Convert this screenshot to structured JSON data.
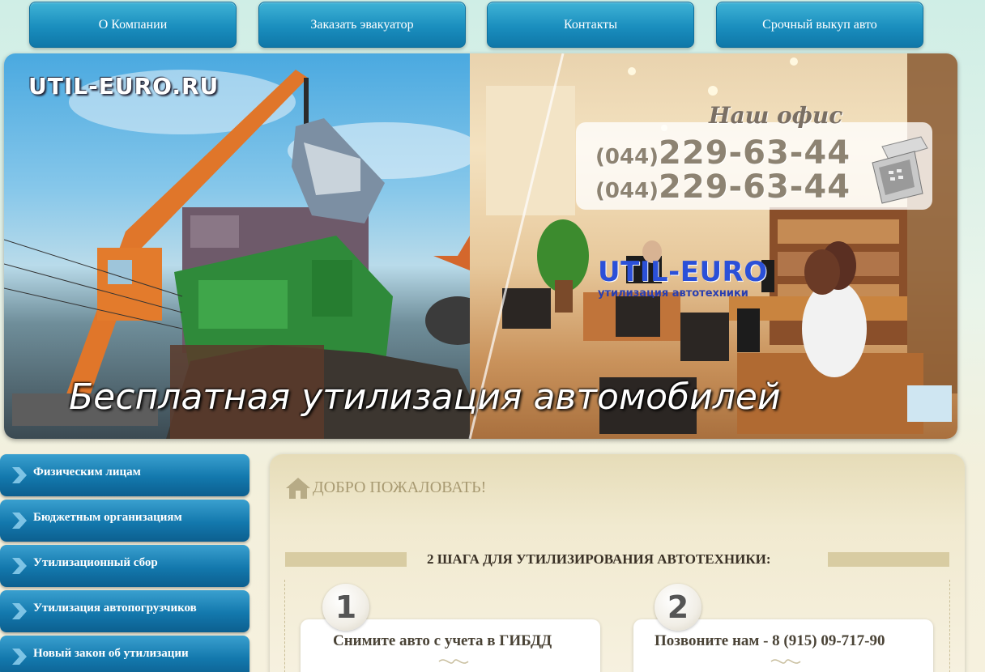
{
  "nav": {
    "items": [
      {
        "label": "О Компании"
      },
      {
        "label": "Заказать эвакуатор"
      },
      {
        "label": "Контакты"
      },
      {
        "label": "Срочный выкуп авто"
      }
    ]
  },
  "banner": {
    "logo_text": "UTIL-EURO.RU",
    "office_label": "Наш офис",
    "phones": [
      {
        "code": "(044)",
        "number": "229-63-44"
      },
      {
        "code": "(044)",
        "number": "229-63-44"
      }
    ],
    "brand_name": "UTIL-EURO",
    "brand_sub": "утилизация автотехники",
    "slogan": "Бесплатная утилизация автомобилей"
  },
  "sidebar": {
    "items": [
      {
        "label": "Физическим лицам"
      },
      {
        "label": "Бюджетным организациям"
      },
      {
        "label": "Утилизационный сбор"
      },
      {
        "label": "Утилизация автопогрузчиков"
      },
      {
        "label": "Новый закон об утилизации"
      }
    ]
  },
  "main": {
    "welcome": "ДОБРО ПОЖАЛОВАТЬ!",
    "steps_heading": "2 ШАГА ДЛЯ УТИЛИЗИРОВАНИЯ АВТОТЕХНИКИ:",
    "steps": [
      {
        "number": "1",
        "title": "Снимите авто с учета в ГИБДД"
      },
      {
        "number": "2",
        "title": "Позвоните нам - 8 (915) 09-717-90"
      }
    ]
  },
  "colors": {
    "nav_button": "#1a8ebe",
    "sidebar_button": "#1378ad",
    "brand_blue": "#2b50d8",
    "panel_bg": "#f1ead0"
  },
  "icons": [
    "home-icon",
    "chevron-right-icon",
    "mobile-phone-icon",
    "swirl-ornament-icon"
  ]
}
